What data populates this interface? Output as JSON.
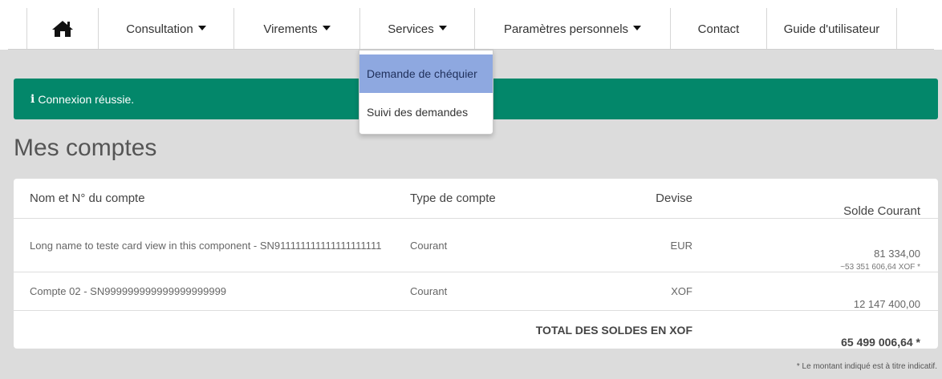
{
  "nav": {
    "items": [
      {
        "label": "Consultation",
        "has_caret": true
      },
      {
        "label": "Virements",
        "has_caret": true
      },
      {
        "label": "Services",
        "has_caret": true
      },
      {
        "label": "Paramètres personnels",
        "has_caret": true
      },
      {
        "label": "Contact",
        "has_caret": false
      },
      {
        "label": "Guide d'utilisateur",
        "has_caret": false
      }
    ],
    "home_icon": "home-icon",
    "services_dropdown": [
      {
        "label": "Demande de chéquier",
        "active": true
      },
      {
        "label": "Suivi des demandes",
        "active": false
      }
    ]
  },
  "alert": {
    "icon": "info-icon",
    "message": "Connexion réussie.",
    "color": "#03876a"
  },
  "page_title": "Mes comptes",
  "accounts_table": {
    "headers": {
      "name": "Nom et N° du compte",
      "type": "Type de compte",
      "currency": "Devise",
      "balance": "Solde Courant"
    },
    "rows": [
      {
        "name": "Long name to teste card view in this component - SN911111111111111111111",
        "type": "Courant",
        "currency": "EUR",
        "balance": "81 334,00",
        "balance_converted": "~53 351 606,64 XOF *"
      },
      {
        "name": "Compte 02 - SN999999999999999999999",
        "type": "Courant",
        "currency": "XOF",
        "balance": "12 147 400,00"
      }
    ],
    "total": {
      "label": "TOTAL DES SOLDES EN XOF",
      "value": "65 499 006,64 *"
    }
  },
  "footnote": "* Le montant indiqué est à titre indicatif."
}
